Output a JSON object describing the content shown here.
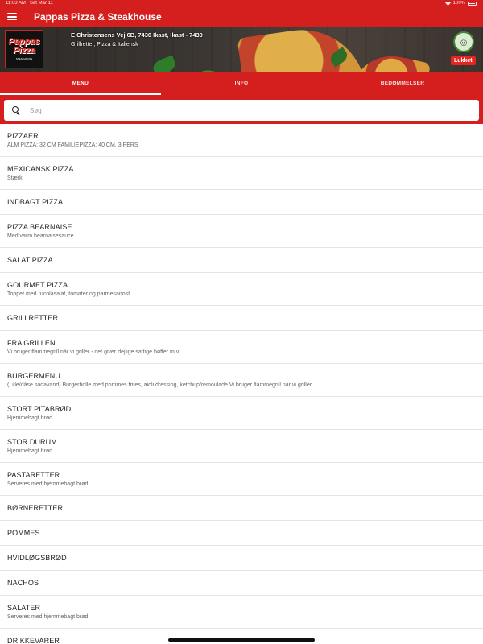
{
  "status_bar": {
    "time": "11:03 AM",
    "date": "Sat Mar 11",
    "battery": "100%"
  },
  "app_bar": {
    "title": "Pappas Pizza & Steakhouse",
    "menu_icon": "hamburger-icon"
  },
  "restaurant": {
    "logo_text_top": "Pappas",
    "logo_text_bottom": "Pizza",
    "logo_sub": "STEAKHOUSE",
    "address": "E Christensens Vej 6B, 7430 Ikast, Ikast - 7430",
    "categories": "Grillretter, Pizza & Italiensk",
    "status": "Lukket"
  },
  "tabs": [
    {
      "label": "MENU",
      "active": true
    },
    {
      "label": "INFO",
      "active": false
    },
    {
      "label": "BEDØMMELSER",
      "active": false
    }
  ],
  "search": {
    "placeholder": "Søg"
  },
  "menu_items": [
    {
      "title": "PIZZAER",
      "desc": "ALM PIZZA: 32 CM  FAMILIEPIZZA: 40 CM, 3 PERS"
    },
    {
      "title": "MEXICANSK PIZZA",
      "desc": "Stærk"
    },
    {
      "title": "INDBAGT PIZZA",
      "desc": ""
    },
    {
      "title": "PIZZA BEARNAISE",
      "desc": "Med varm bearnaisesauce"
    },
    {
      "title": "SALAT PIZZA",
      "desc": ""
    },
    {
      "title": "GOURMET PIZZA",
      "desc": "Toppet med rucolasalat, tomater og parmesanost"
    },
    {
      "title": "GRILLRETTER",
      "desc": ""
    },
    {
      "title": "FRA GRILLEN",
      "desc": "Vi bruger flammegrill når vi griller - det giver dejlige saftige bøffer m.v."
    },
    {
      "title": "BURGERMENU",
      "desc": "(Lille/dåse sodavand) Burgerbolle med pommes frites, aioli dressing, ketchup/remoulade Vi bruger flammegrill når vi griller"
    },
    {
      "title": "STORT PITABRØD",
      "desc": "Hjemmebagt brød"
    },
    {
      "title": "STOR DURUM",
      "desc": "Hjemmebagt brød"
    },
    {
      "title": "PASTARETTER",
      "desc": "Serveres med hjemmebagt brød"
    },
    {
      "title": "BØRNERETTER",
      "desc": ""
    },
    {
      "title": "POMMES",
      "desc": ""
    },
    {
      "title": "HVIDLØGSBRØD",
      "desc": ""
    },
    {
      "title": "NACHOS",
      "desc": ""
    },
    {
      "title": "SALATER",
      "desc": "Serveres med hjemmebagt brød"
    },
    {
      "title": "DRIKKEVARER",
      "desc": ""
    }
  ],
  "colors": {
    "primary": "#d51e1e",
    "badge": "#e52620",
    "divider": "#e4e4e4"
  }
}
